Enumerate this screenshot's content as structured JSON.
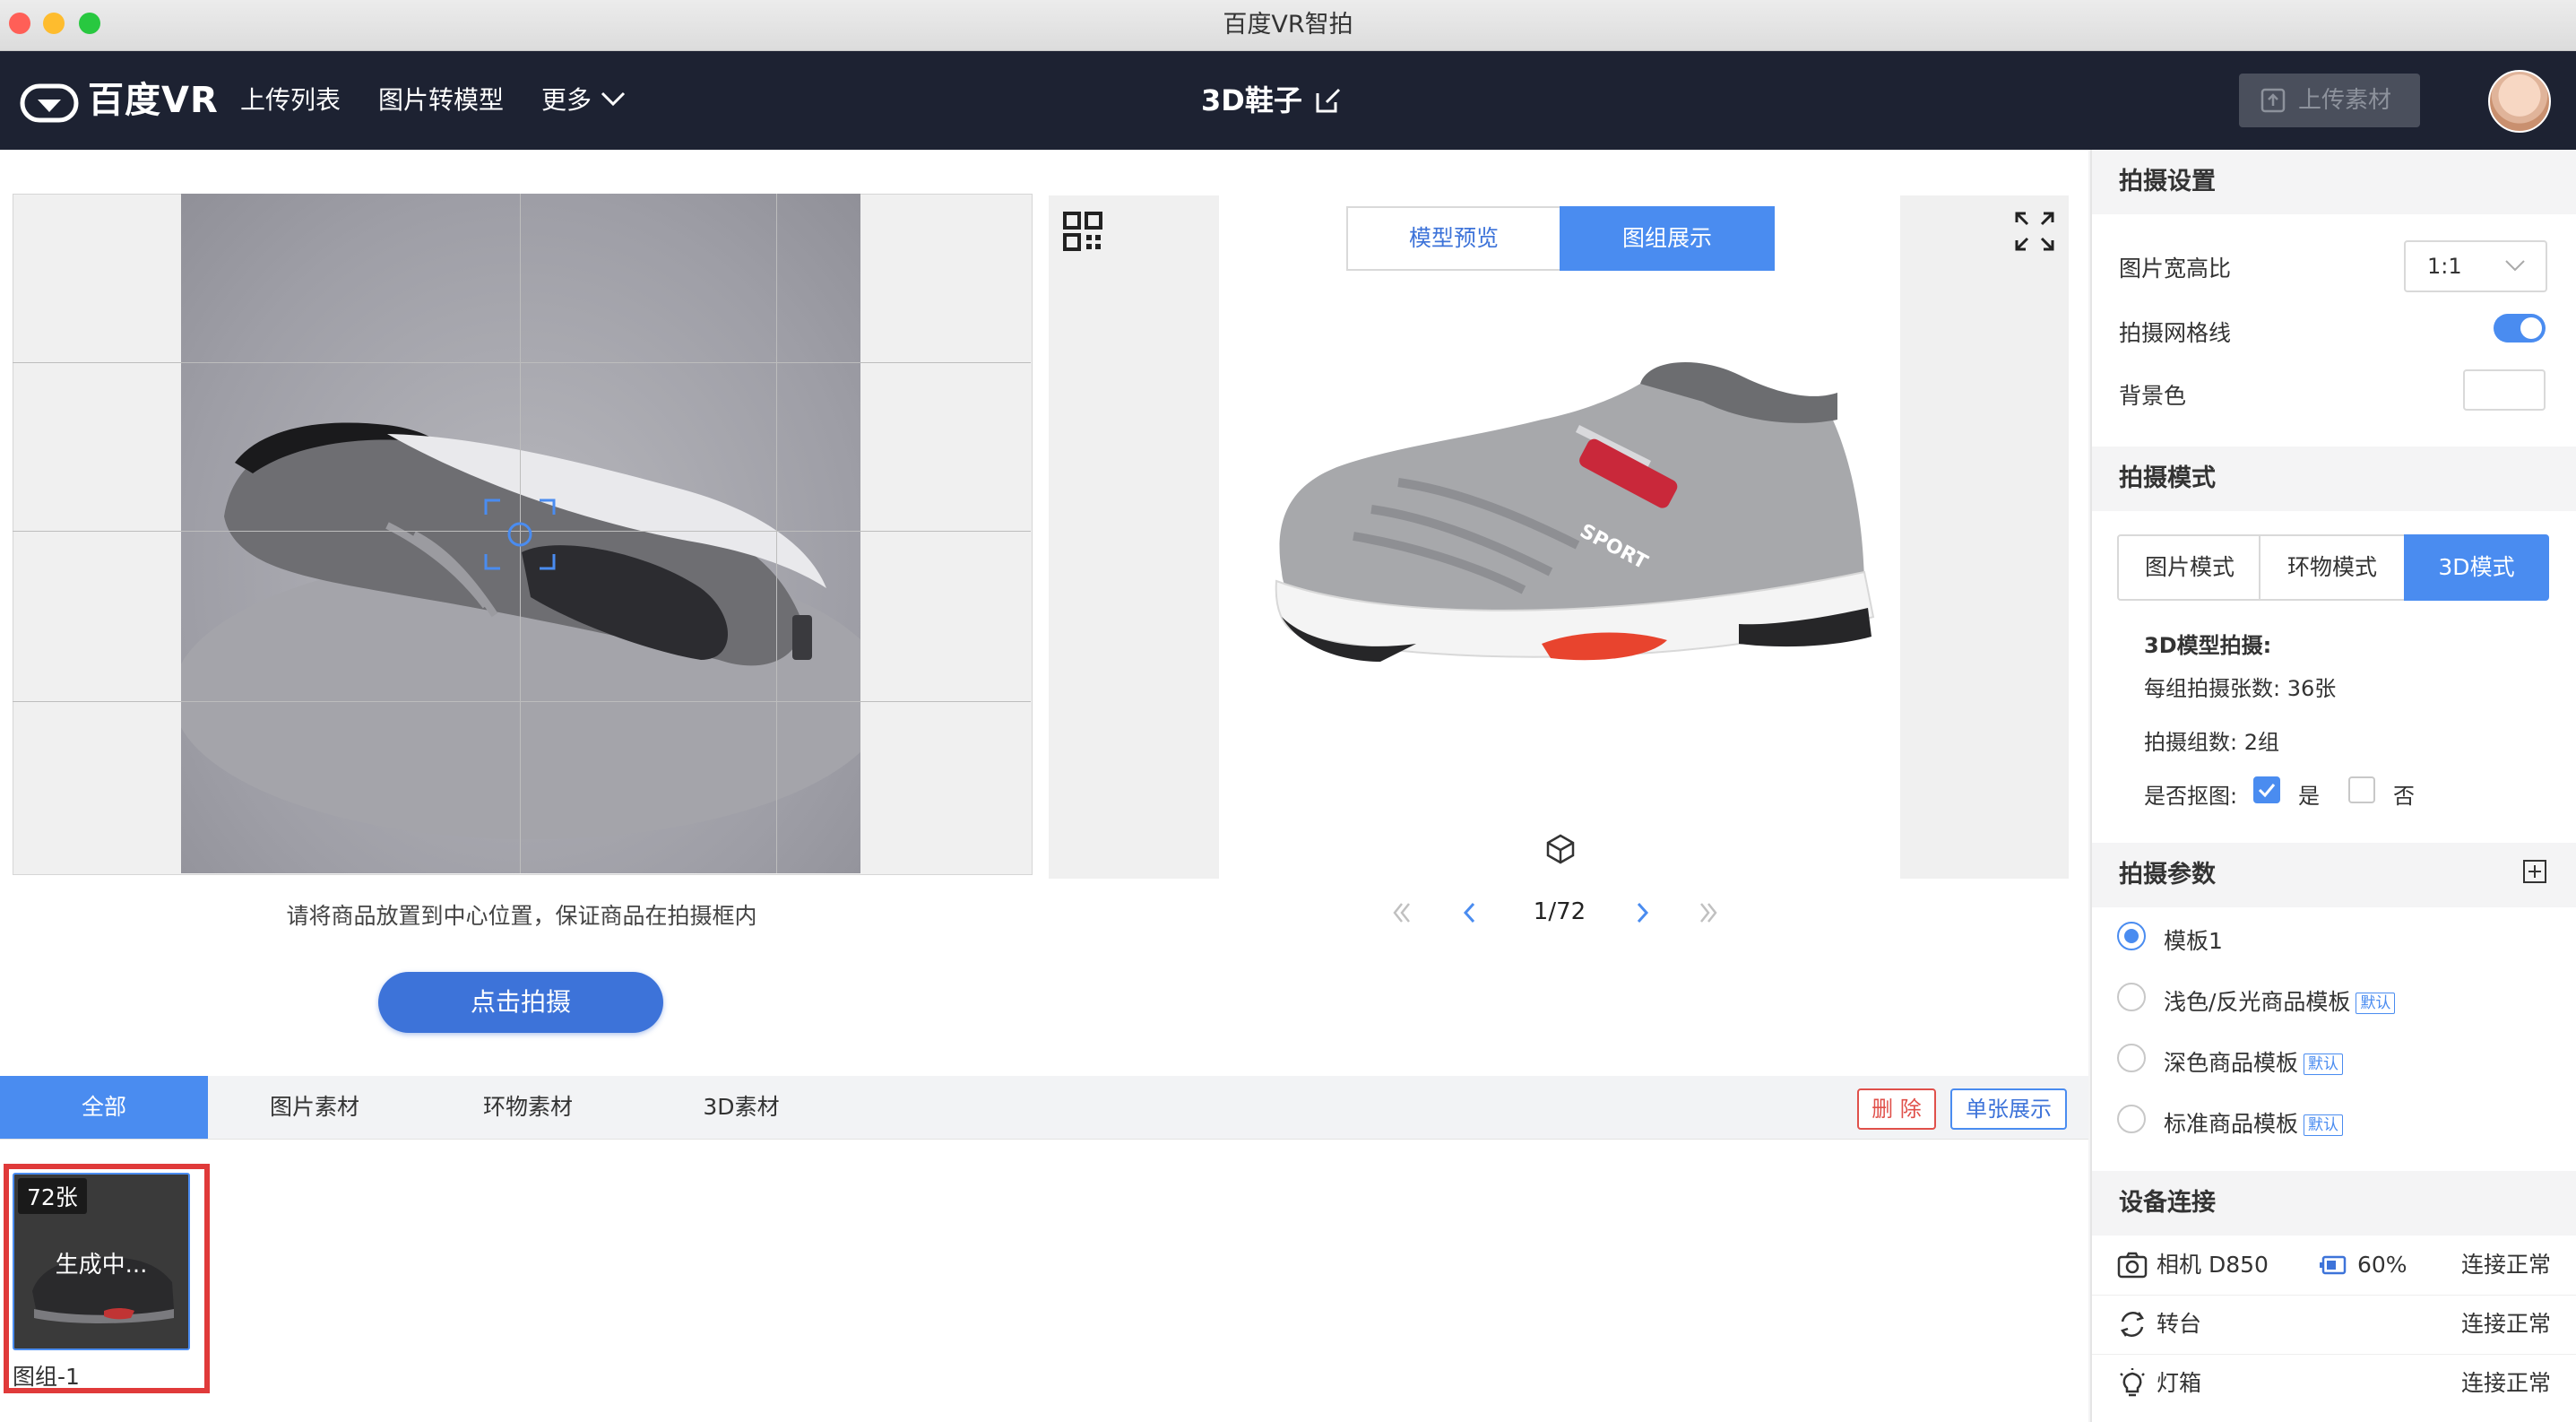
{
  "window": {
    "title": "百度VR智拍",
    "colors": {
      "close": "#ff5f57",
      "minimize": "#febc2e",
      "zoom": "#28c840"
    }
  },
  "nav": {
    "logo_text": "百度VR",
    "links": [
      "上传列表",
      "图片转模型",
      "更多"
    ],
    "project_title": "3D鞋子",
    "upload_label": "上传素材"
  },
  "camera": {
    "hint": "请将商品放置到中心位置，保证商品在拍摄框内",
    "shoot_label": "点击拍摄"
  },
  "preview": {
    "tabs": [
      "模型预览",
      "图组展示"
    ],
    "active_tab": "图组展示",
    "page": "1/72",
    "shoe_text": "SPORT"
  },
  "materials": {
    "tabs": [
      "全部",
      "图片素材",
      "环物素材",
      "3D素材"
    ],
    "active_tab": "全部",
    "delete_label": "删 除",
    "single_label": "单张展示",
    "items": [
      {
        "count": "72张",
        "status": "生成中...",
        "label": "图组-1"
      }
    ]
  },
  "settings": {
    "shoot_settings": {
      "title": "拍摄设置",
      "ratio_label": "图片宽高比",
      "ratio_value": "1:1",
      "grid_label": "拍摄网格线",
      "grid_on": true,
      "bg_label": "背景色"
    },
    "shoot_mode": {
      "title": "拍摄模式",
      "modes": [
        "图片模式",
        "环物模式",
        "3D模式"
      ],
      "active": "3D模式",
      "detail_title": "3D模型拍摄:",
      "per_group": "每组拍摄张数: 36张",
      "groups": "拍摄组数: 2组",
      "cutout_label": "是否抠图:",
      "yes": "是",
      "no": "否",
      "cutout": true
    },
    "shoot_params": {
      "title": "拍摄参数",
      "templates": [
        {
          "name": "模板1",
          "badge": "",
          "selected": true
        },
        {
          "name": "浅色/反光商品模板",
          "badge": "默认",
          "selected": false
        },
        {
          "name": "深色商品模板",
          "badge": "默认",
          "selected": false
        },
        {
          "name": "标准商品模板",
          "badge": "默认",
          "selected": false
        }
      ]
    },
    "devices": {
      "title": "设备连接",
      "camera": {
        "name": "相机 D850",
        "battery": "60%",
        "status": "连接正常"
      },
      "turntable": {
        "name": "转台",
        "status": "连接正常"
      },
      "lightbox": {
        "name": "灯箱",
        "status": "连接正常"
      }
    }
  },
  "colors": {
    "accent": "#4a8cf0",
    "nav_bg": "#1d2232",
    "danger": "#e0504a"
  }
}
